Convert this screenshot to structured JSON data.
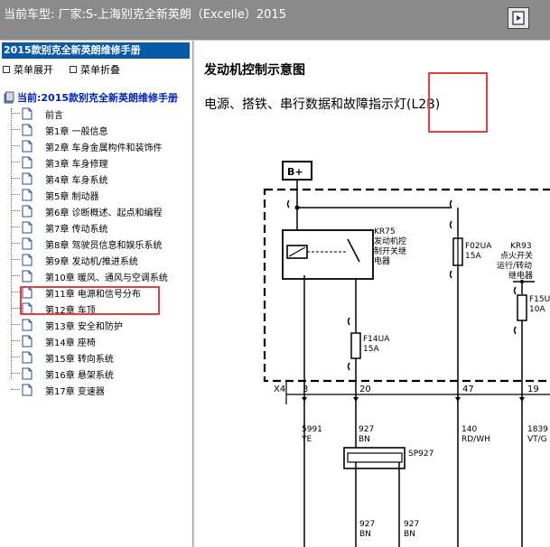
{
  "window": {
    "title": "当前车型:   厂家:S-上海别克全新英朗（Excelle）2015"
  },
  "sidebar": {
    "book_title": "2015款别克全新英朗维修手册",
    "expand_label": "菜单展开",
    "collapse_label": "菜单折叠",
    "current_label": "当前:2015款别克全新英朗维修手册",
    "items": [
      {
        "label": "前言"
      },
      {
        "label": "第1章 一般信息"
      },
      {
        "label": "第2章 车身金属构件和装饰件"
      },
      {
        "label": "第3章 车身修理"
      },
      {
        "label": "第4章 车身系统"
      },
      {
        "label": "第5章 制动器"
      },
      {
        "label": "第6章 诊断概述、起点和编程"
      },
      {
        "label": "第7章 传动系统"
      },
      {
        "label": "第8章 驾驶员信息和娱乐系统"
      },
      {
        "label": "第9章 发动机/推进系统"
      },
      {
        "label": "第10章 暖风、通风与空调系统"
      },
      {
        "label": "第11章 电源和信号分布"
      },
      {
        "label": "第12章 车顶"
      },
      {
        "label": "第13章 安全和防护"
      },
      {
        "label": "第14章 座椅"
      },
      {
        "label": "第15章 转向系统"
      },
      {
        "label": "第16章 悬架系统"
      },
      {
        "label": "第17章 变速器"
      }
    ]
  },
  "content": {
    "heading": "发动机控制示意图",
    "subheading": "电源、搭铁、串行数据和故障指示灯(L2B)"
  },
  "diagram": {
    "bplus": "B+",
    "kr75": [
      "KR75",
      "发动机控",
      "制开关继",
      "电器"
    ],
    "f02ua": [
      "F02UA",
      "15A"
    ],
    "kr93": [
      "KR93",
      "点火开关",
      "运行/转动",
      "继电器"
    ],
    "f15u": [
      "F15U",
      "10A"
    ],
    "f14ua": [
      "F14UA",
      "15A"
    ],
    "x4": "X4",
    "pins": [
      "3",
      "20",
      "47",
      "19"
    ],
    "wires": [
      {
        "num": "5991",
        "color": "YE"
      },
      {
        "num": "927",
        "color": "BN"
      },
      {
        "num": "140",
        "color": "RD/WH"
      },
      {
        "num": "1839",
        "color": "VT/G"
      }
    ],
    "sp927": "SP927",
    "bottom_wires": [
      {
        "num": "927",
        "color": "BN"
      },
      {
        "num": "927",
        "color": "BN"
      }
    ]
  }
}
